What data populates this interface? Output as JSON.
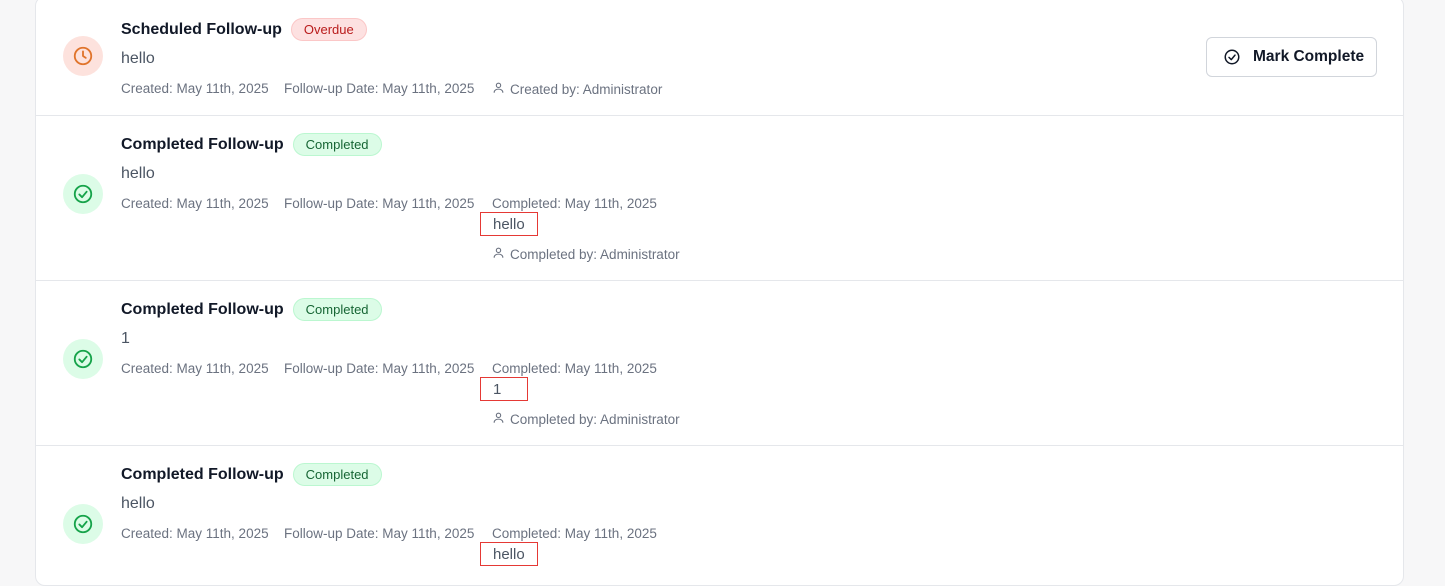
{
  "followups": [
    {
      "title": "Scheduled Follow-up",
      "status": "Overdue",
      "note": "hello",
      "created": "Created: May 11th, 2025",
      "followup_date": "Follow-up Date: May 11th, 2025",
      "created_by": "Created by: Administrator",
      "action_label": "Mark Complete"
    },
    {
      "title": "Completed Follow-up",
      "status": "Completed",
      "note": "hello",
      "created": "Created: May 11th, 2025",
      "followup_date": "Follow-up Date: May 11th, 2025",
      "completed": "Completed: May 11th, 2025",
      "completion_note": "hello",
      "completed_by": "Completed by: Administrator"
    },
    {
      "title": "Completed Follow-up",
      "status": "Completed",
      "note": "1",
      "created": "Created: May 11th, 2025",
      "followup_date": "Follow-up Date: May 11th, 2025",
      "completed": "Completed: May 11th, 2025",
      "completion_note": "1",
      "completed_by": "Completed by: Administrator"
    },
    {
      "title": "Completed Follow-up",
      "status": "Completed",
      "note": "hello",
      "created": "Created: May 11th, 2025",
      "followup_date": "Follow-up Date: May 11th, 2025",
      "completed": "Completed: May 11th, 2025",
      "completion_note": "hello"
    }
  ],
  "colors": {
    "overdue": "#e0742c",
    "completed": "#16a34a",
    "highlight_box": "#e53935"
  },
  "icons": {
    "overdue": "clock-icon",
    "completed": "check-circle-icon",
    "user": "user-icon",
    "action": "check-circle-icon"
  }
}
